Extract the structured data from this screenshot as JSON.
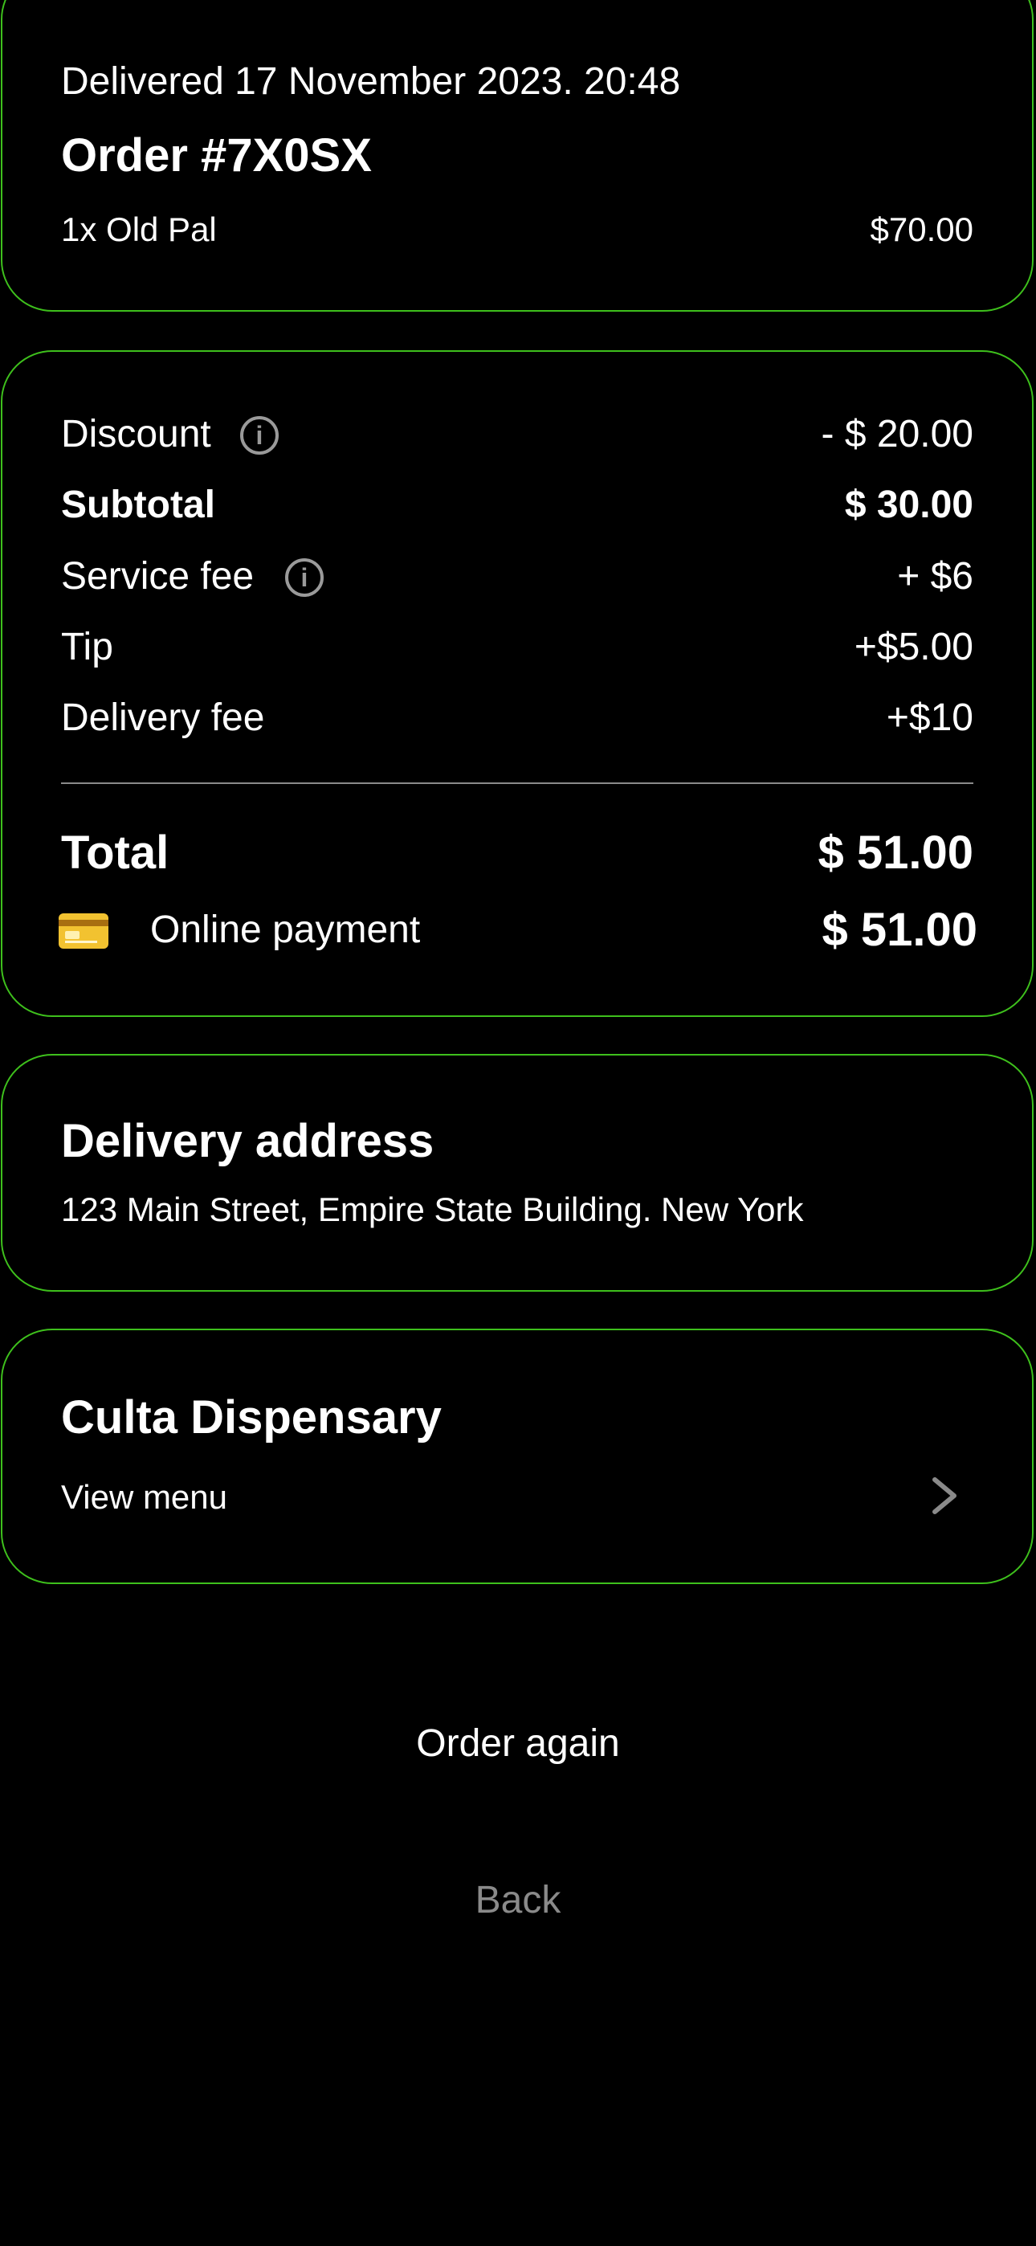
{
  "order": {
    "status_line": "Delivered  17 November 2023.  20:48",
    "title": "Order #7X0SX",
    "item": {
      "label": "1x Old Pal",
      "price": "$70.00"
    }
  },
  "summary": {
    "discount": {
      "label": "Discount",
      "value": "- $ 20.00"
    },
    "subtotal": {
      "label": "Subtotal",
      "value": "$ 30.00"
    },
    "service_fee": {
      "label": "Service fee",
      "value": "+ $6"
    },
    "tip": {
      "label": "Tip",
      "value": "+$5.00"
    },
    "delivery_fee": {
      "label": "Delivery fee",
      "value": "+$10"
    },
    "total": {
      "label": "Total",
      "value": "$ 51.00"
    },
    "payment": {
      "label": "Online payment",
      "value": "$ 51.00",
      "icon": "credit-card-icon"
    }
  },
  "address": {
    "heading": "Delivery address",
    "text": "123 Main Street, Empire State Building. New York"
  },
  "store": {
    "name": "Culta Dispensary",
    "view_menu": "View menu"
  },
  "actions": {
    "order_again": "Order again",
    "back": "Back"
  },
  "colors": {
    "background": "#000000",
    "card_border": "#3ec01c",
    "text": "#ffffff",
    "muted": "#8a8a8a",
    "card_icon": "#f2c230"
  }
}
